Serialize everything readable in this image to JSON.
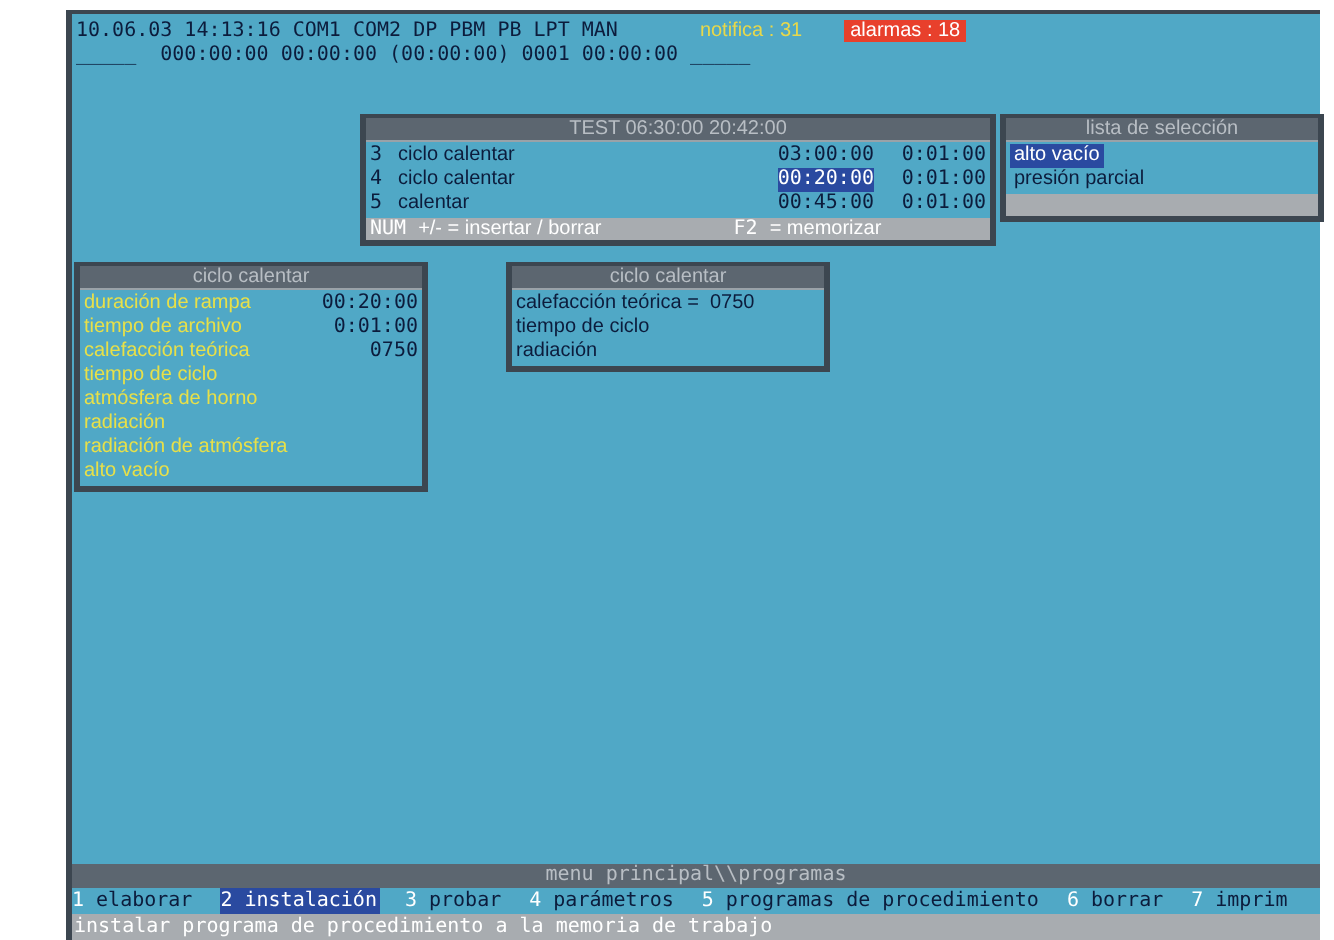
{
  "header": {
    "status_text": "10.06.03 14:13:16 COM1 COM2 DP PBM PB LPT MAN",
    "notifications": "notifica : 31",
    "alarms": "alarmas : 18",
    "counters": "_____  000:00:00 00:00:00 (00:00:00) 0001 00:00:00 _____"
  },
  "program_window": {
    "title": "TEST 06:30:00 20:42:00",
    "rows": [
      {
        "number": "3",
        "name": "ciclo calentar",
        "duration": "03:00:00",
        "interval": "0:01:00",
        "selected": false
      },
      {
        "number": "4",
        "name": "ciclo calentar",
        "duration": "00:20:00",
        "interval": "0:01:00",
        "selected": true
      },
      {
        "number": "5",
        "name": "calentar",
        "duration": "00:45:00",
        "interval": "0:01:00",
        "selected": false
      }
    ],
    "footer": [
      {
        "key": "NUM",
        "text": "+/- = insertar / borrar"
      },
      {
        "key": "F2",
        "text": "= memorizar"
      }
    ]
  },
  "selection_list": {
    "title": "lista de selección",
    "items": [
      {
        "label": "alto vacío",
        "selected": true
      },
      {
        "label": "presión parcial",
        "selected": false
      }
    ]
  },
  "step_parameters": {
    "title": "ciclo calentar",
    "rows": [
      {
        "label": "duración de rampa",
        "value": "00:20:00"
      },
      {
        "label": "tiempo de archivo",
        "value": "0:01:00"
      },
      {
        "label": "calefacción teórica",
        "value": "0750"
      },
      {
        "label": "tiempo de ciclo"
      },
      {
        "label": "atmósfera de horno"
      },
      {
        "label": "radiación"
      },
      {
        "label": "radiación de atmósfera"
      },
      {
        "label": "alto vacío"
      }
    ]
  },
  "step_summary": {
    "title": "ciclo calentar",
    "lines": [
      "calefacción teórica =  0750",
      "tiempo de ciclo",
      "radiación"
    ]
  },
  "main_menu": {
    "title": "menu principal\\\\programas",
    "items": [
      {
        "number": "1",
        "label": "elaborar",
        "selected": false
      },
      {
        "number": "2",
        "label": "instalación",
        "selected": true
      },
      {
        "number": "3",
        "label": "probar",
        "selected": false
      },
      {
        "number": "4",
        "label": "parámetros",
        "selected": false
      },
      {
        "number": "5",
        "label": "programas de procedimiento",
        "selected": false
      },
      {
        "number": "6",
        "label": "borrar",
        "selected": false
      },
      {
        "number": "7",
        "label": "imprim",
        "selected": false
      }
    ],
    "hint": "instalar programa de procedimiento a la memoria de trabajo"
  }
}
